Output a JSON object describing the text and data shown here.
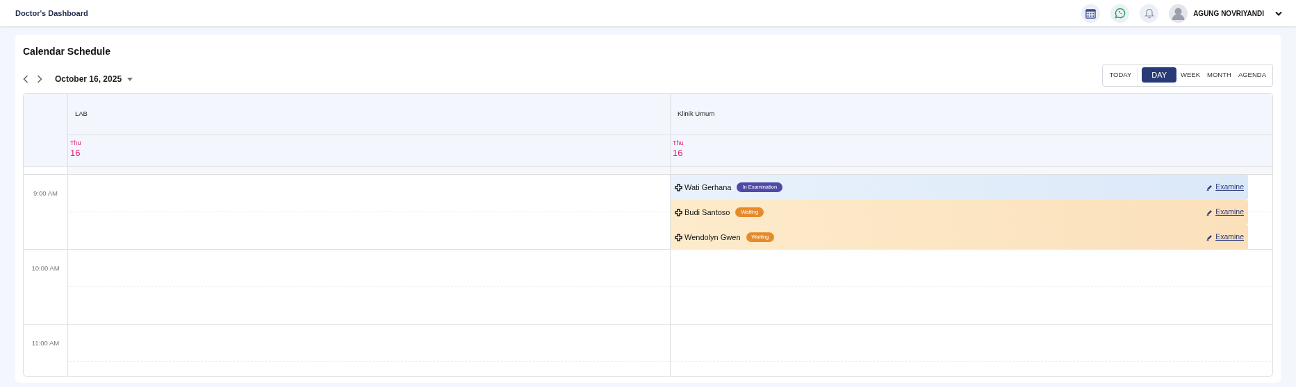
{
  "header": {
    "title": "Doctor's Dashboard",
    "user": {
      "name": "AGUNG NOVRIYANDI"
    }
  },
  "calendar": {
    "title": "Calendar Schedule",
    "date": "October 16, 2025",
    "views": [
      {
        "label": "TODAY",
        "selected": false
      },
      {
        "label": "DAY",
        "selected": true
      },
      {
        "label": "WEEK",
        "selected": false
      },
      {
        "label": "MONTH",
        "selected": false
      },
      {
        "label": "AGENDA",
        "selected": false
      }
    ],
    "resources": [
      {
        "name": "LAB",
        "weekday": "Thu",
        "day": "16"
      },
      {
        "name": "Klinik Umum",
        "weekday": "Thu",
        "day": "16",
        "events": [
          {
            "patient": "Wati Gerhana",
            "status": {
              "label": "In Examination",
              "kind": "examination"
            },
            "action": "Examine"
          },
          {
            "patient": "Budi Santoso",
            "status": {
              "label": "Waiting",
              "kind": "waiting"
            },
            "action": "Examine"
          },
          {
            "patient": "Wendolyn Gwen",
            "status": {
              "label": "Waiting",
              "kind": "waiting"
            },
            "action": "Examine"
          }
        ]
      }
    ],
    "hours": [
      "9:00 AM",
      "10:00 AM",
      "11:00 AM"
    ]
  }
}
